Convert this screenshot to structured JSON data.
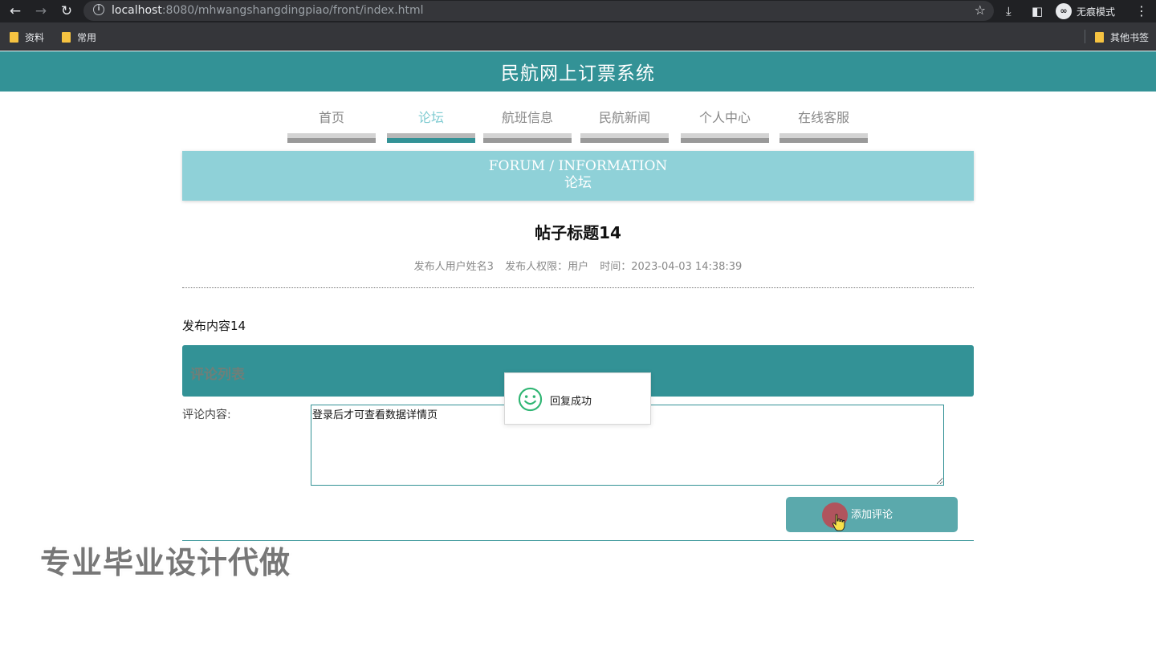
{
  "browser": {
    "url_host": "localhost",
    "url_rest": ":8080/mhwangshangdingpiao/front/index.html",
    "incognito_label": "无痕模式",
    "bookmarks": [
      "资料",
      "常用"
    ],
    "other_bookmarks": "其他书签"
  },
  "site": {
    "title": "民航网上订票系统"
  },
  "nav": {
    "items": [
      {
        "label": "首页"
      },
      {
        "label": "论坛"
      },
      {
        "label": "航班信息"
      },
      {
        "label": "民航新闻"
      },
      {
        "label": "个人中心"
      },
      {
        "label": "在线客服"
      }
    ],
    "active": "论坛"
  },
  "banner": {
    "en": "FORUM / INFORMATION",
    "cn": "论坛"
  },
  "post": {
    "title": "帖子标题14",
    "author": "发布人用户姓名3",
    "role": "发布人权限：用户",
    "time": "时间：2023-04-03 14:38:39",
    "content": "发布内容14"
  },
  "comments": {
    "header": "评论列表",
    "field_label": "评论内容:",
    "field_value": "登录后才可查看数据详情页",
    "submit_label": "添加评论"
  },
  "toast": {
    "message": "回复成功"
  },
  "watermark": {
    "text": "专业毕业设计代做"
  },
  "colors": {
    "primary": "#339296",
    "banner": "#8fd1d8",
    "button": "#5ba9ac",
    "toast_icon": "#2fb573"
  }
}
